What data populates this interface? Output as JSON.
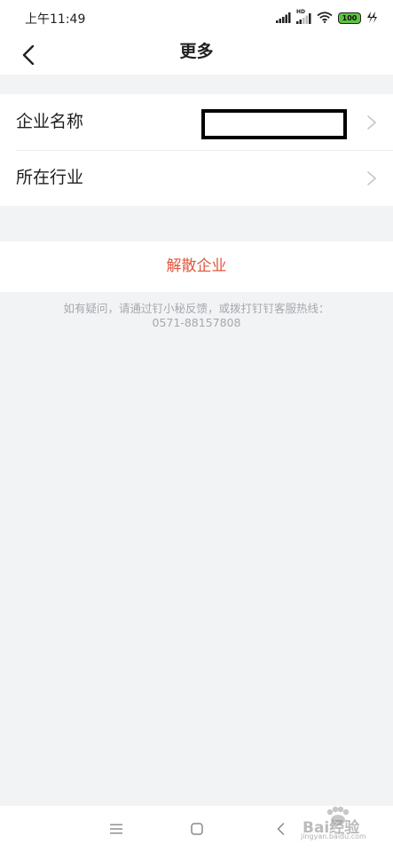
{
  "status_bar": {
    "time": "上午11:49",
    "battery": "100",
    "hd": "HD",
    "icons": [
      "signal-icon",
      "hd-signal-icon",
      "wifi-icon",
      "battery-icon",
      "charging-icon"
    ]
  },
  "nav": {
    "title": "更多",
    "back_icon": "back-arrow-icon"
  },
  "settings": {
    "rows": [
      {
        "label": "企业名称",
        "value_redacted": true,
        "chevron": "chevron-right-icon"
      },
      {
        "label": "所在行业",
        "chevron": "chevron-right-icon"
      }
    ]
  },
  "action": {
    "dissolve_label": "解散企业",
    "color": "#e0573d"
  },
  "hint": {
    "line1": "如有疑问，请通过钉小秘反馈，或拨打钉钉客服热线：",
    "line2": "0571-88157808"
  },
  "system_nav": {
    "buttons": [
      "menu-icon",
      "home-icon",
      "back-icon"
    ]
  },
  "watermark": {
    "brand": "Bai经验",
    "url": "jingyan.baidu.com"
  },
  "colors": {
    "background": "#f2f3f5",
    "card": "#ffffff",
    "danger": "#e0573d",
    "hint_text": "#a6a8ad",
    "battery": "#5ec242"
  }
}
